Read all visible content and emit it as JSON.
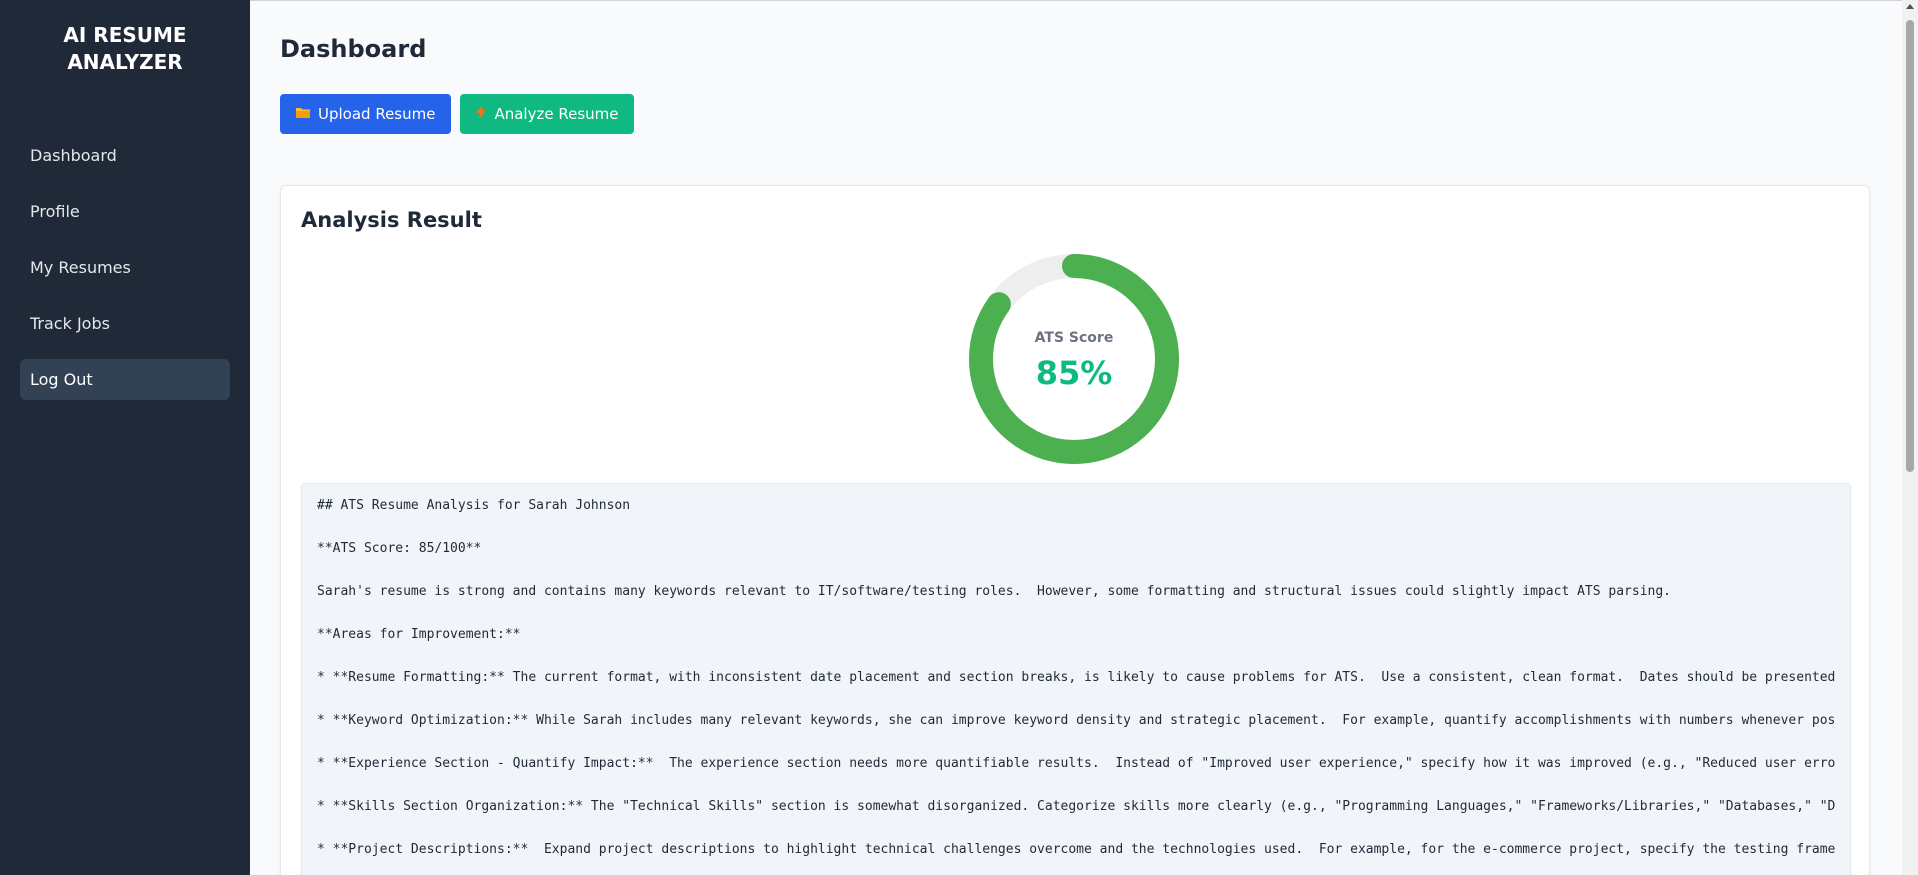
{
  "app": {
    "title": "AI RESUME ANALYZER"
  },
  "sidebar": {
    "items": [
      {
        "label": "Dashboard"
      },
      {
        "label": "Profile"
      },
      {
        "label": "My Resumes"
      },
      {
        "label": "Track Jobs"
      },
      {
        "label": "Log Out",
        "active": true
      }
    ]
  },
  "header": {
    "title": "Dashboard"
  },
  "actions": {
    "upload_label": "Upload Resume",
    "upload_icon": "folder-icon",
    "analyze_label": "Analyze Resume",
    "analyze_icon": "lightning-icon"
  },
  "result": {
    "title": "Analysis Result",
    "score_label": "ATS Score",
    "score_value": "85%",
    "score_fraction": 0.85,
    "colors": {
      "ring": "#4caf50",
      "track": "#eeeeee",
      "score_text": "#10b981"
    },
    "lines": [
      "## ATS Resume Analysis for Sarah Johnson",
      "**ATS Score: 85/100**",
      "Sarah's resume is strong and contains many keywords relevant to IT/software/testing roles.  However, some formatting and structural issues could slightly impact ATS parsing.",
      "**Areas for Improvement:**",
      "* **Resume Formatting:** The current format, with inconsistent date placement and section breaks, is likely to cause problems for ATS.  Use a consistent, clean format.  Dates should be presented",
      "* **Keyword Optimization:** While Sarah includes many relevant keywords, she can improve keyword density and strategic placement.  For example, quantify accomplishments with numbers whenever pos",
      "* **Experience Section - Quantify Impact:**  The experience section needs more quantifiable results.  Instead of \"Improved user experience,\" specify how it was improved (e.g., \"Reduced user erro",
      "* **Skills Section Organization:** The \"Technical Skills\" section is somewhat disorganized. Categorize skills more clearly (e.g., \"Programming Languages,\" \"Frameworks/Libraries,\" \"Databases,\" \"D",
      "* **Project Descriptions:**  Expand project descriptions to highlight technical challenges overcome and the technologies used.  For example, for the e-commerce project, specify the testing frame"
    ]
  }
}
